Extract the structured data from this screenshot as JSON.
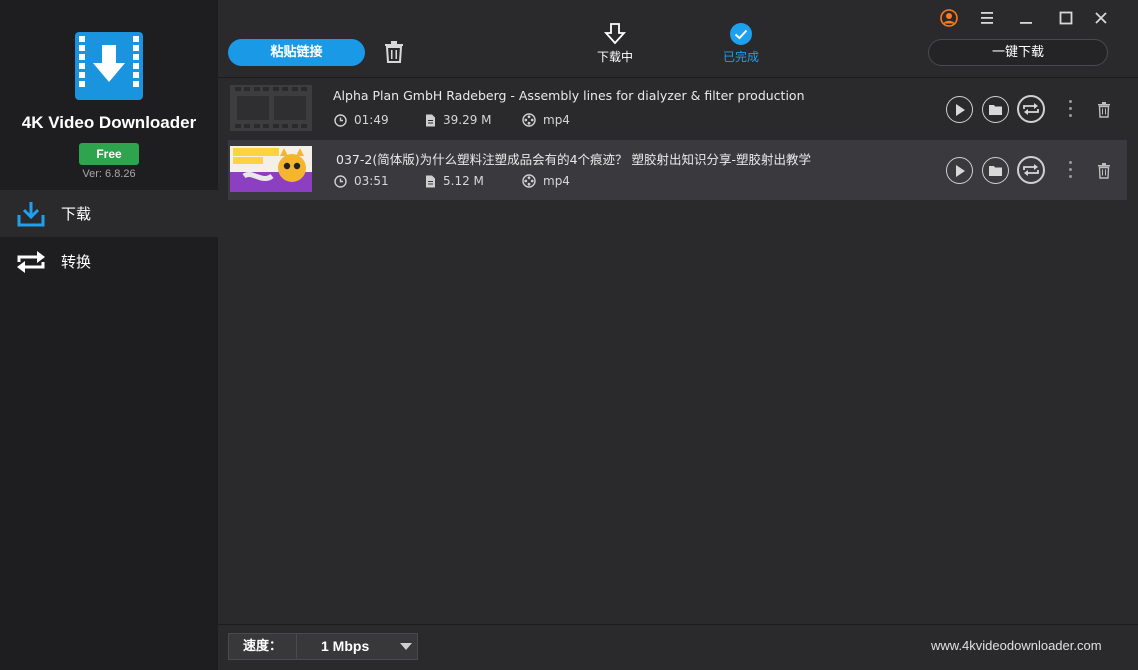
{
  "sidebar": {
    "app_name": "4K Video Downloader",
    "plan_badge": "Free",
    "version": "Ver: 6.8.26",
    "items": [
      {
        "label": "下载",
        "icon": "download-icon"
      },
      {
        "label": "转换",
        "icon": "convert-icon"
      }
    ]
  },
  "toolbar": {
    "paste_label": "粘贴链接",
    "tabs": [
      {
        "label": "下载中",
        "icon": "download-arrow-icon"
      },
      {
        "label": "已完成",
        "icon": "check-circle-icon"
      }
    ],
    "one_click_label": "一键下载"
  },
  "downloads": [
    {
      "title": "Alpha Plan GmbH Radeberg - Assembly lines for dialyzer & filter production",
      "duration": "01:49",
      "size": "39.29 M",
      "format": "mp4",
      "thumbnail": "film-placeholder"
    },
    {
      "title": "037-2(简体版)为什么塑料注塑成品会有的4个痕迹？ 塑胶射出知识分享-塑胶射出教学",
      "duration": "03:51",
      "size": "5.12 M",
      "format": "mp4",
      "thumbnail": "video-frame"
    }
  ],
  "footer": {
    "speed_label": "速度：",
    "speed_value": "1 Mbps",
    "website": "www.4kvideodownloader.com"
  },
  "colors": {
    "accent": "#1a9ae6",
    "free_badge": "#2ea44f",
    "account": "#ff7a1a",
    "background": "#2a2a2d",
    "sidebar": "#1e1e20"
  }
}
